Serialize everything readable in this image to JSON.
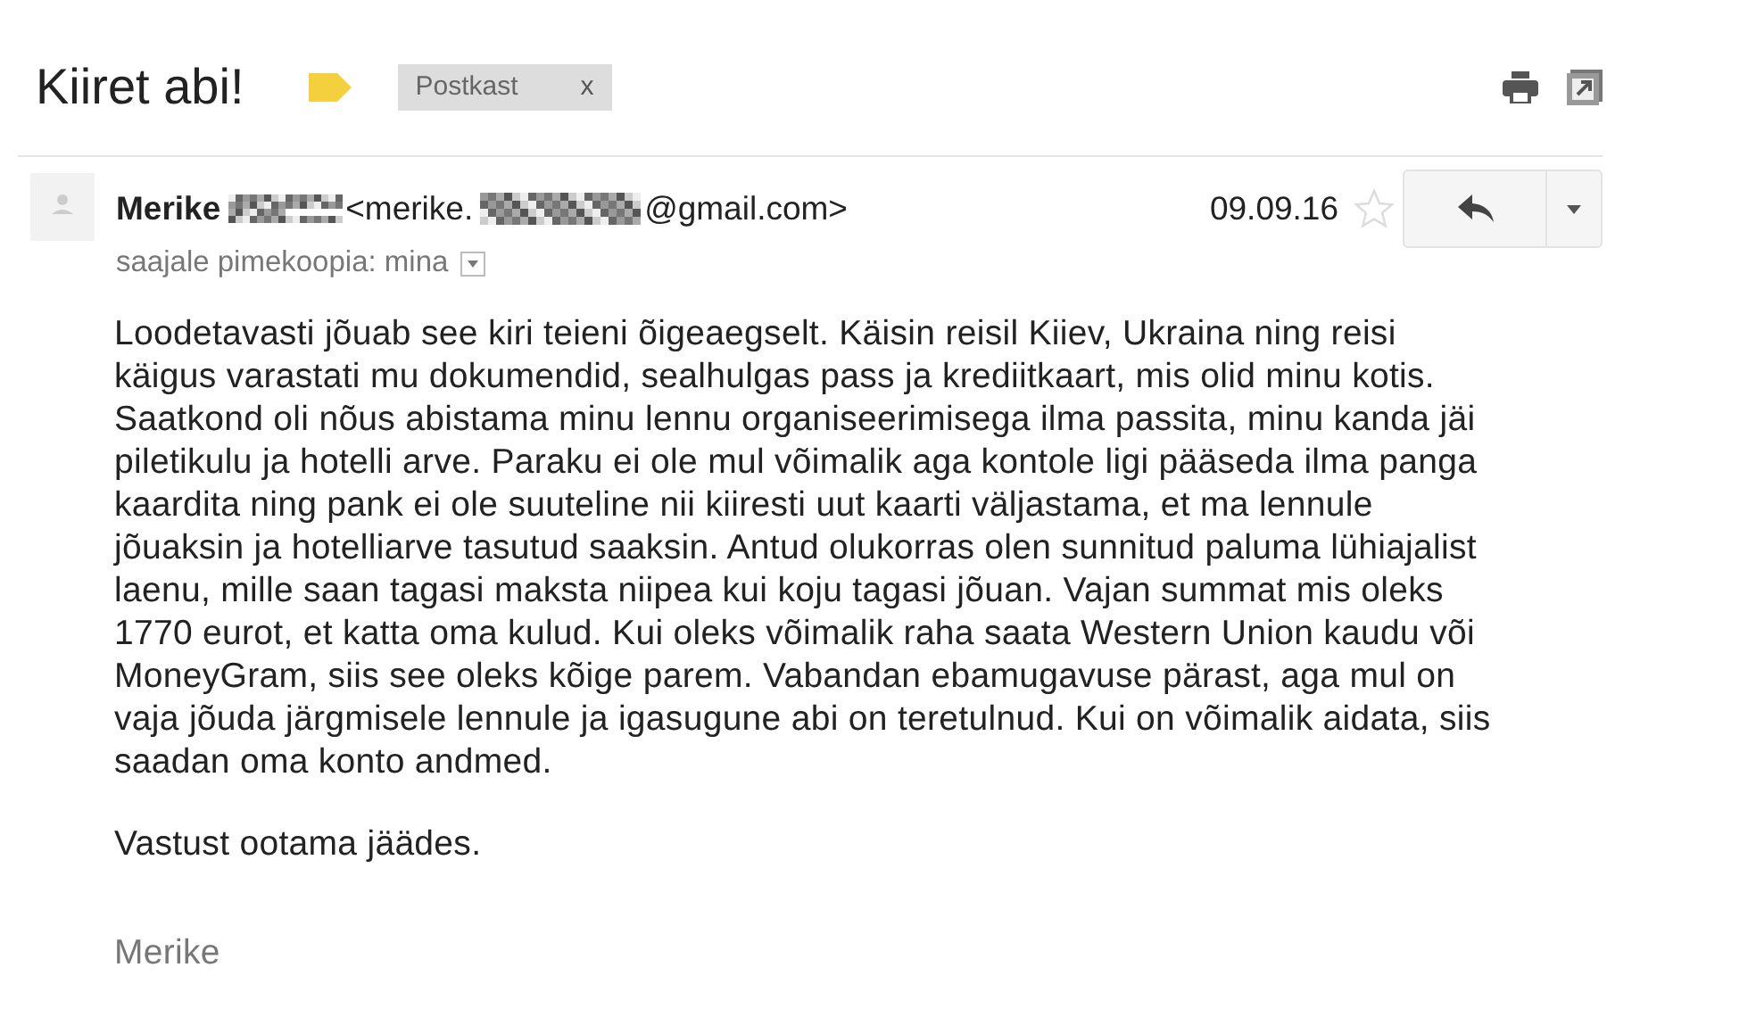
{
  "subject": "Kiiret abi!",
  "important": true,
  "labels": [
    {
      "name": "Postkast",
      "remove": "x"
    }
  ],
  "message": {
    "sender_name": "Merike",
    "email_start": "<merike.",
    "email_end": "@gmail.com>",
    "date": "09.09.16",
    "starred": false,
    "recipients": "saajale pimekoopia: mina",
    "body_lines": [
      "Loodetavasti jõuab see kiri teieni õigeaegselt. Käisin reisil Kiiev, Ukraina ning reisi",
      "käigus varastati mu dokumendid, sealhulgas pass ja krediitkaart, mis olid minu kotis.",
      "Saatkond oli nõus abistama minu lennu organiseerimisega ilma passita, minu kanda jäi",
      "piletikulu ja hotelli arve. Paraku ei ole mul võimalik aga kontole ligi pääseda ilma panga",
      "kaardita ning pank ei ole suuteline nii kiiresti uut kaarti väljastama, et ma lennule",
      "jõuaksin ja hotelliarve tasutud saaksin. Antud olukorras olen sunnitud paluma lühiajalist",
      "laenu, mille saan tagasi maksta niipea kui koju tagasi jõuan. Vajan summat mis oleks",
      "1770 eurot, et katta oma kulud. Kui oleks võimalik raha saata Western Union kaudu või",
      "MoneyGram, siis see oleks kõige parem. Vabandan ebamugavuse pärast, aga mul on",
      "vaja jõuda järgmisele lennule ja igasugune abi on teretulnud. Kui on võimalik aidata, siis",
      "saadan oma konto andmed."
    ],
    "closing": "Vastust ootama jäädes.",
    "signature": "Merike"
  }
}
